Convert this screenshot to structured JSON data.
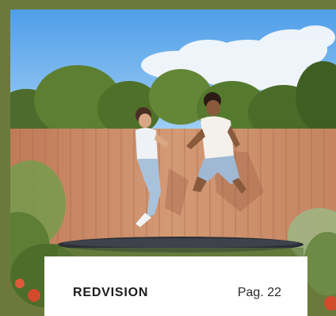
{
  "card": {
    "brand": "REDVISION",
    "page_label": "Pag. 22"
  },
  "photo": {
    "scene": "couple-jumping-on-trampoline"
  },
  "colors": {
    "frame": "#6b7a3c",
    "sky": "#6fb3ef",
    "fence": "#c98a66",
    "card": "#ffffff"
  }
}
